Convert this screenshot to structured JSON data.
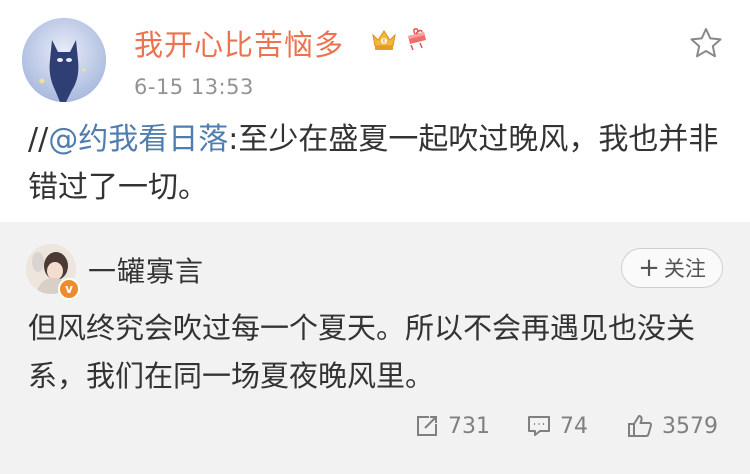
{
  "post": {
    "username": "我开心比苦恼多",
    "timestamp": "6-15 13:53",
    "text_prefix": "//",
    "mention": "@约我看日落",
    "text_body": ":至少在盛夏一起吹过晚风，我也并非错过了一切。"
  },
  "original": {
    "username": "一罐寡言",
    "vip_mark": "v",
    "follow_label": "关注",
    "text": "但风终究会吹过每一个夏天。所以不会再遇见也没关系，我们在同一场夏夜晚风里。",
    "stats": {
      "reposts": "731",
      "comments": "74",
      "likes": "3579"
    }
  },
  "colors": {
    "username": "#eb7350",
    "mention": "#507daf",
    "meta": "#939393",
    "repost_bg": "#f2f2f2"
  },
  "icons": [
    "crown-badge-icon",
    "gift-badge-icon",
    "star-icon",
    "plus-icon",
    "repost-icon",
    "comment-icon",
    "like-icon"
  ]
}
